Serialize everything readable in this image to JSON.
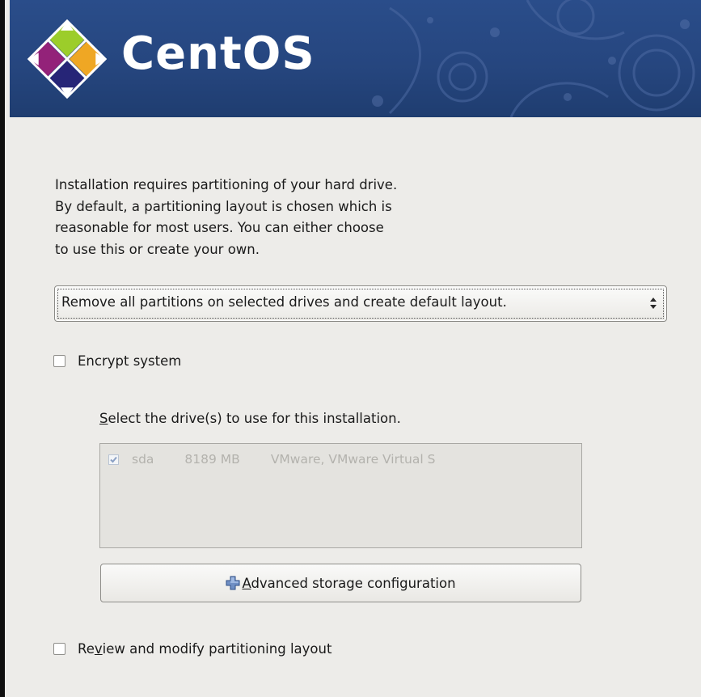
{
  "header": {
    "brand": "CentOS"
  },
  "intro_lines": [
    "Installation requires partitioning of your hard drive.",
    "By default, a partitioning layout is chosen which is",
    "reasonable for most users.  You can either choose",
    "to use this or create your own."
  ],
  "partition_select": {
    "selected_value": "Remove all partitions on selected drives and create default layout."
  },
  "encrypt": {
    "label": "Encrypt system",
    "checked": false
  },
  "drives": {
    "label_mnemonic": "S",
    "label_rest": "elect the drive(s) to use for this installation.",
    "rows": [
      {
        "checked": true,
        "name": "sda",
        "size": "8189 MB",
        "model": "VMware, VMware Virtual S"
      }
    ]
  },
  "advanced_button": {
    "mnemonic": "A",
    "label_rest": "dvanced storage configuration"
  },
  "review": {
    "label_pre": "Re",
    "mnemonic": "v",
    "label_post": "iew and modify partitioning layout",
    "checked": false
  },
  "colors": {
    "banner": "#26467f",
    "background": "#edece9",
    "disabled_text": "#b3b2ad"
  }
}
